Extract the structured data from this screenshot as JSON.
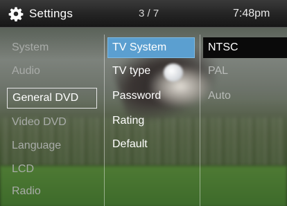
{
  "header": {
    "icon": "gear-icon",
    "title": "Settings",
    "page": "3 / 7",
    "time": "7:48pm"
  },
  "categories": [
    {
      "label": "System"
    },
    {
      "label": "Audio"
    },
    {
      "label": "General DVD"
    },
    {
      "label": "Video DVD"
    },
    {
      "label": "Language"
    },
    {
      "label": "LCD"
    },
    {
      "label": "Radio"
    }
  ],
  "selected_category": "General DVD",
  "submenu": [
    {
      "label": "TV System"
    },
    {
      "label": "TV type"
    },
    {
      "label": "Password"
    },
    {
      "label": "Rating"
    },
    {
      "label": "Default"
    }
  ],
  "highlighted_submenu": "TV System",
  "options": [
    {
      "label": "NTSC"
    },
    {
      "label": "PAL"
    },
    {
      "label": "Auto"
    }
  ],
  "highlighted_option": "NTSC",
  "colors": {
    "highlight": "#5b9fd0",
    "option_highlight": "#0a0a0a",
    "topbar": "#232323"
  }
}
